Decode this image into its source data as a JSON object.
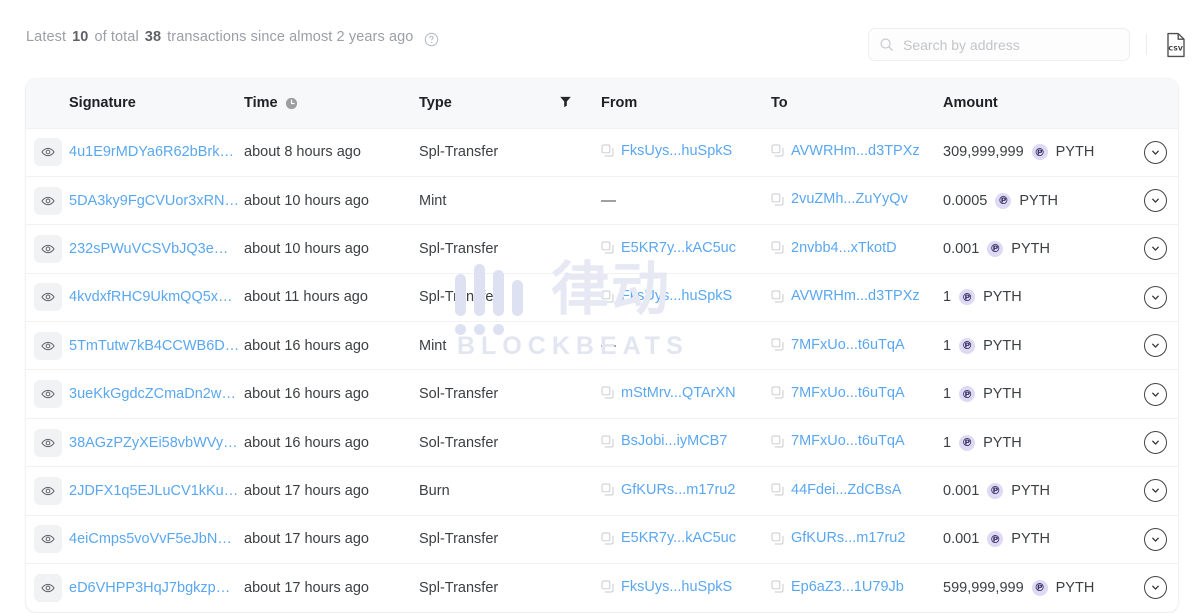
{
  "header": {
    "summary_prefix": "Latest",
    "summary_count": "10",
    "summary_middle": "of total",
    "summary_total": "38",
    "summary_suffix": "transactions since almost 2 years ago",
    "help_icon": "question-circle-icon",
    "search": {
      "placeholder": "Search by address",
      "value": "",
      "icon": "search-icon"
    },
    "csv": {
      "label": "CSV",
      "icon": "csv-download-icon"
    }
  },
  "watermark": {
    "cn": "律动",
    "en": "BLOCKBEATS"
  },
  "table": {
    "columns": [
      {
        "key": "eye",
        "label": ""
      },
      {
        "key": "signature",
        "label": "Signature"
      },
      {
        "key": "time",
        "label": "Time",
        "icon": "clock-icon"
      },
      {
        "key": "type",
        "label": "Type"
      },
      {
        "key": "filter",
        "label": "",
        "icon": "filter-icon"
      },
      {
        "key": "from",
        "label": "From"
      },
      {
        "key": "to",
        "label": "To"
      },
      {
        "key": "amount",
        "label": "Amount"
      },
      {
        "key": "expand",
        "label": ""
      }
    ],
    "rows": [
      {
        "signature": "4u1E9rMDYa6R62bBrk…",
        "time": "about 8 hours ago",
        "type": "Spl-Transfer",
        "from": "FksUys...huSpkS",
        "to": "AVWRHm...d3TPXz",
        "amount": "309,999,999",
        "token": "PYTH"
      },
      {
        "signature": "5DA3ky9FgCVUor3xRN…",
        "time": "about 10 hours ago",
        "type": "Mint",
        "from": "—",
        "to": "2vuZMh...ZuYyQv",
        "amount": "0.0005",
        "token": "PYTH"
      },
      {
        "signature": "232sPWuVCSVbJQ3e…",
        "time": "about 10 hours ago",
        "type": "Spl-Transfer",
        "from": "E5KR7y...kAC5uc",
        "to": "2nvbb4...xTkotD",
        "amount": "0.001",
        "token": "PYTH"
      },
      {
        "signature": "4kvdxfRHC9UkmQQ5x…",
        "time": "about 11 hours ago",
        "type": "Spl-Transfer",
        "from": "FksUys...huSpkS",
        "to": "AVWRHm...d3TPXz",
        "amount": "1",
        "token": "PYTH"
      },
      {
        "signature": "5TmTutw7kB4CCWB6D…",
        "time": "about 16 hours ago",
        "type": "Mint",
        "from": "—",
        "to": "7MFxUo...t6uTqA",
        "amount": "1",
        "token": "PYTH"
      },
      {
        "signature": "3ueKkGgdcZCmaDn2w…",
        "time": "about 16 hours ago",
        "type": "Sol-Transfer",
        "from": "mStMrv...QTArXN",
        "to": "7MFxUo...t6uTqA",
        "amount": "1",
        "token": "PYTH"
      },
      {
        "signature": "38AGzPZyXEi58vbWVy…",
        "time": "about 16 hours ago",
        "type": "Sol-Transfer",
        "from": "BsJobi...iyMCB7",
        "to": "7MFxUo...t6uTqA",
        "amount": "1",
        "token": "PYTH"
      },
      {
        "signature": "2JDFX1q5EJLuCV1kKu…",
        "time": "about 17 hours ago",
        "type": "Burn",
        "from": "GfKURs...m17ru2",
        "to": "44Fdei...ZdCBsA",
        "amount": "0.001",
        "token": "PYTH"
      },
      {
        "signature": "4eiCmps5voVvF5eJbN…",
        "time": "about 17 hours ago",
        "type": "Spl-Transfer",
        "from": "E5KR7y...kAC5uc",
        "to": "GfKURs...m17ru2",
        "amount": "0.001",
        "token": "PYTH"
      },
      {
        "signature": "eD6VHPP3HqJ7bgkzp…",
        "time": "about 17 hours ago",
        "type": "Spl-Transfer",
        "from": "FksUys...huSpkS",
        "to": "Ep6aZ3...1U79Jb",
        "amount": "599,999,999",
        "token": "PYTH"
      }
    ]
  },
  "colors": {
    "link": "#5aa7f0",
    "token_badge": "#ded9f5",
    "header_bg": "#f7f8f9",
    "text": "#3c4043",
    "muted": "#9aa0a6"
  }
}
